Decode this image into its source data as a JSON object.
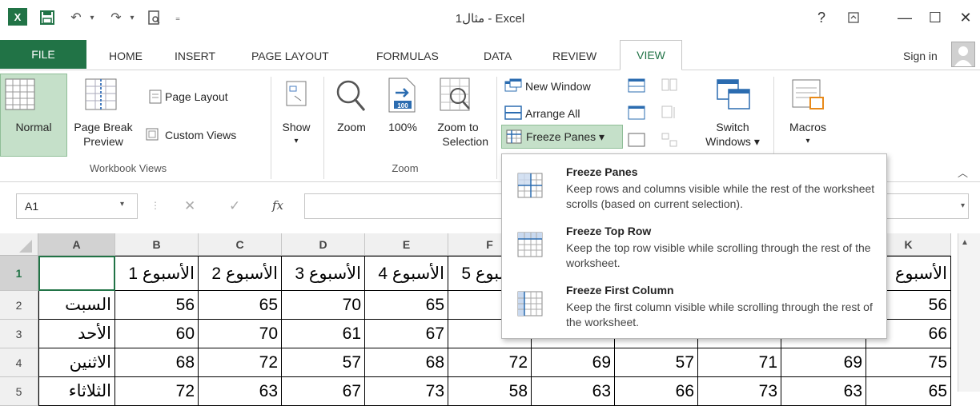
{
  "window": {
    "title": "مثال1 - Excel",
    "help": "?",
    "minimize": "—",
    "maximize": "☐",
    "close": "✕"
  },
  "qat": {
    "excel_icon": "X",
    "save": "💾",
    "undo": "↶",
    "redo": "↷",
    "preview": "🔍"
  },
  "tabs": {
    "file": "FILE",
    "home": "HOME",
    "insert": "INSERT",
    "page_layout": "PAGE LAYOUT",
    "formulas": "FORMULAS",
    "data": "DATA",
    "review": "REVIEW",
    "view": "VIEW",
    "sign_in": "Sign in"
  },
  "ribbon": {
    "normal": "Normal",
    "page_break_1": "Page Break",
    "page_break_2": "Preview",
    "page_layout": "Page Layout",
    "custom_views": "Custom Views",
    "workbook_views": "Workbook Views",
    "show": "Show",
    "zoom": "Zoom",
    "zoom100": "100%",
    "zoom_sel_1": "Zoom to",
    "zoom_sel_2": "Selection",
    "zoom_group": "Zoom",
    "new_window": "New Window",
    "arrange_all": "Arrange All",
    "freeze_panes": "Freeze Panes ▾",
    "switch_1": "Switch",
    "switch_2": "Windows ▾",
    "macros": "Macros",
    "badge100": "100"
  },
  "formula_bar": {
    "namebox": "A1",
    "fx": "fx",
    "cancel": "✕",
    "enter": "✓"
  },
  "dropdown": [
    {
      "title": "Freeze Panes",
      "desc": "Keep rows and columns visible while the rest of the worksheet scrolls (based on current selection)."
    },
    {
      "title": "Freeze Top Row",
      "desc": "Keep the top row visible while scrolling through the rest of the worksheet."
    },
    {
      "title": "Freeze First Column",
      "desc": "Keep the first column visible while scrolling through the rest of the worksheet."
    }
  ],
  "sheet": {
    "columns": [
      "A",
      "B",
      "C",
      "D",
      "E",
      "F",
      "G",
      "H",
      "I",
      "J",
      "K"
    ],
    "rows": [
      "1",
      "2",
      "3",
      "4",
      "5"
    ],
    "row1": [
      "",
      "الأسبوع 1",
      "الأسبوع 2",
      "الأسبوع 3",
      "الأسبوع 4",
      "الأسبوع 5",
      "",
      "",
      "",
      "",
      "الأسبوع"
    ],
    "row2": [
      "السبت",
      "56",
      "65",
      "70",
      "65",
      "",
      "",
      "",
      "",
      "",
      "56"
    ],
    "row3": [
      "الأحد",
      "60",
      "70",
      "61",
      "67",
      "",
      "",
      "",
      "",
      "",
      "66"
    ],
    "row4": [
      "الاثنين",
      "68",
      "72",
      "57",
      "68",
      "72",
      "69",
      "57",
      "71",
      "69",
      "75"
    ],
    "row5": [
      "الثلاثاء",
      "72",
      "63",
      "67",
      "73",
      "58",
      "63",
      "66",
      "73",
      "63",
      "65"
    ]
  }
}
